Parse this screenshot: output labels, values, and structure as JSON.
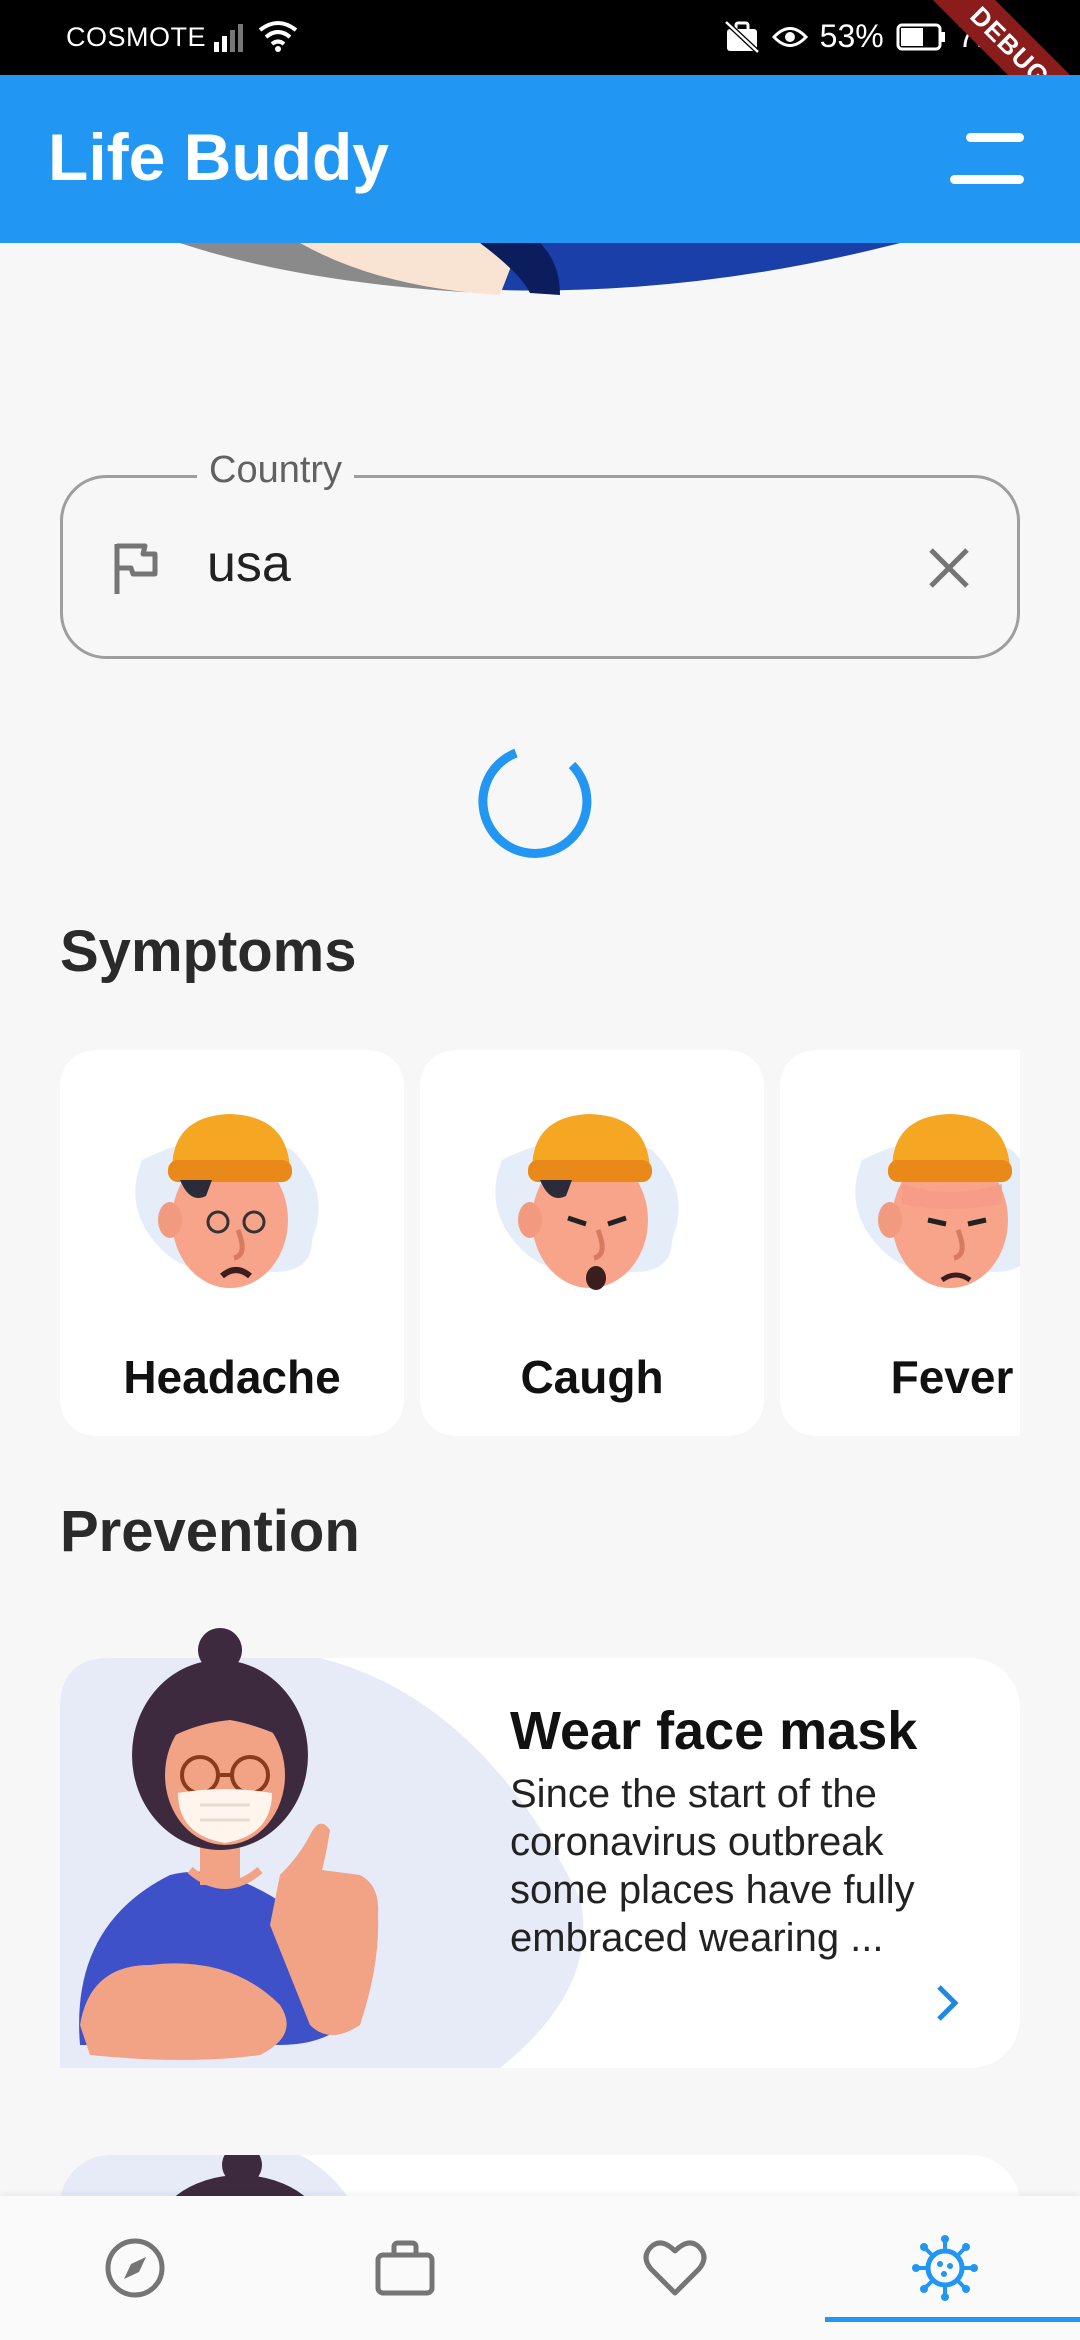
{
  "status_bar": {
    "carrier": "COSMOTE",
    "battery": "53%",
    "time": "7:17",
    "debug_banner": "DEBUG"
  },
  "app_bar": {
    "title": "Life Buddy",
    "menu_icon": "menu-icon"
  },
  "country_field": {
    "label": "Country",
    "value": "usa",
    "prefix_icon": "flag-icon",
    "suffix_icon": "close-icon"
  },
  "symptoms": {
    "title": "Symptoms",
    "items": [
      {
        "label": "Headache"
      },
      {
        "label": "Caugh"
      },
      {
        "label": "Fever"
      }
    ]
  },
  "prevention": {
    "title": "Prevention",
    "items": [
      {
        "title": "Wear face mask",
        "description_lines": [
          "Since the start of the",
          "coronavirus outbreak",
          "some places have fully",
          "embraced wearing ..."
        ]
      }
    ]
  },
  "bottom_nav": {
    "items": [
      {
        "icon": "compass-icon",
        "active": false
      },
      {
        "icon": "briefcase-icon",
        "active": false
      },
      {
        "icon": "heart-icon",
        "active": false
      },
      {
        "icon": "virus-icon",
        "active": true
      }
    ]
  },
  "colors": {
    "primary": "#2196f3",
    "background": "#f7f7f8",
    "nav_inactive": "#757575"
  }
}
